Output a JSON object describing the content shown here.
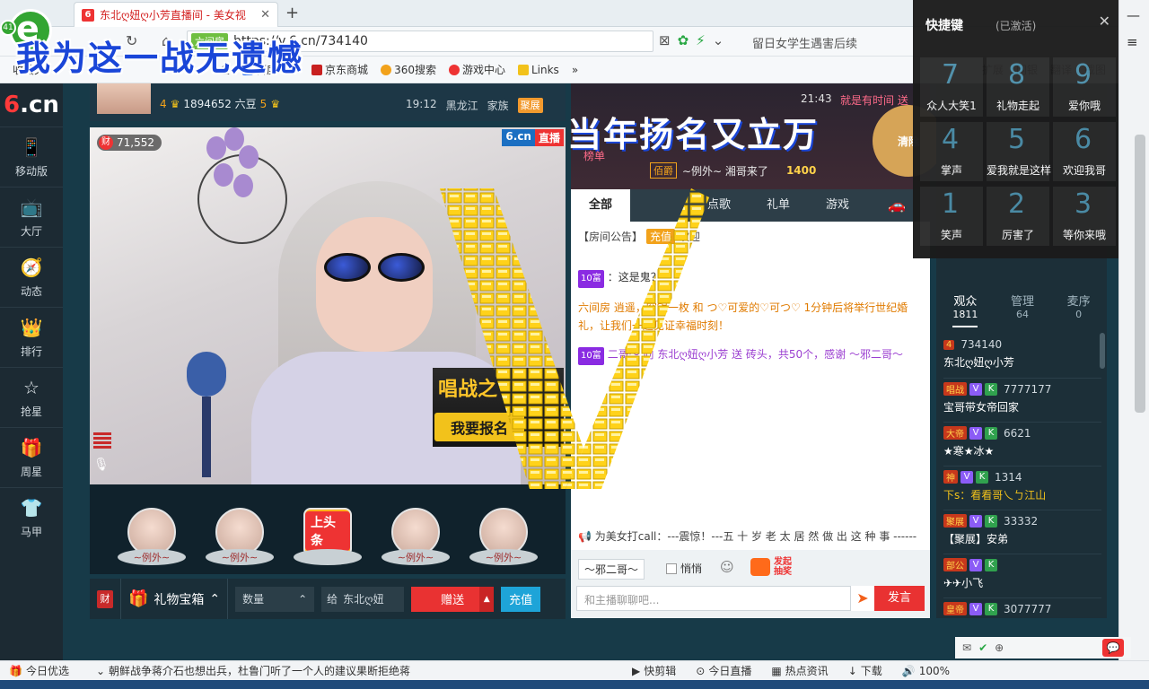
{
  "browser": {
    "tab_title": "东北ღ妞ღ小芳直播间 - 美女视",
    "tab_close": "✕",
    "new_tab": "+",
    "badge_number": "41",
    "address_safe_label": "六间房",
    "address_url": "https://v.6.cn/734140",
    "search_text": "留日女学生遇害后续",
    "bookmarks": [
      "收藏夹",
      "全",
      "百度一下",
      "京东商城",
      "360搜索",
      "游戏中心",
      "Links",
      "»"
    ],
    "bookmarks_right": [
      "扩展",
      "网银",
      "翻译",
      "截图",
      "模式"
    ]
  },
  "overlay_slogan": "我为这一战无遗憾",
  "site": {
    "logo_text": "6.cn",
    "logo_sub": "六间房",
    "nav": [
      {
        "icon": "📱",
        "label": "移动版"
      },
      {
        "icon": "📺",
        "label": "大厅"
      },
      {
        "icon": "🧭",
        "label": "动态"
      },
      {
        "icon": "👑",
        "label": "排行"
      },
      {
        "icon": "☆",
        "label": "抢星"
      },
      {
        "icon": "🎁",
        "label": "周星"
      },
      {
        "icon": "👕",
        "label": "马甲"
      }
    ]
  },
  "room": {
    "level_left": "4",
    "beans": "1894652 六豆",
    "level_right": "5",
    "time": "19:12",
    "location": "黑龙江",
    "family_label": "家族",
    "family_tag": "聚展"
  },
  "video": {
    "viewer_count": "71,552",
    "cai": "财",
    "cn_badge": "6.cn",
    "live_badge": "直播",
    "sing_title": "唱战之",
    "sing_button": "我要报名"
  },
  "gift_strip": {
    "slots": [
      "∼例外∼",
      "∼例外∼",
      "上头条",
      "∼例外∼",
      "∼例外∼"
    ]
  },
  "gift_bar": {
    "cai": "财",
    "giftbox_label": "礼物宝箱",
    "qty_placeholder": "数量",
    "to_label": "给",
    "to_name": "东北ღ妞",
    "send_label": "赠送",
    "recharge_label": "充值"
  },
  "chat": {
    "time": "21:43",
    "slogan": "就是有时间 送",
    "big_title": "当年扬名又立万",
    "rank_label": "榜单",
    "rank_tag": "佰爵",
    "rank_name": "∼例外∼ 湘哥来了",
    "rank_num": "1400",
    "clear_label": "清除",
    "tabs": [
      "全部",
      "",
      "点歌",
      "礼单",
      "游戏",
      "🚗"
    ],
    "notice_label": "【房间公告】",
    "notice_recharge": "充值",
    "notice_welcome": "欢迎",
    "messages": [
      {
        "level": "10富",
        "text": "：这是鬼？"
      },
      {
        "level": "",
        "text": "六间房 逍遥，穷银一枚 和 つ♡可爱的♡可つ♡ 1分钟后将举行世纪婚礼，让我们一起见证幸福时刻！"
      },
      {
        "level": "10富",
        "text": "二哥～ 向 东北ღ妞ღ小芳 送 砖头，共50个，感谢 ～邪二哥～"
      }
    ],
    "call_line": "为美女打call：---震惊！---五 十 岁 老 太 居 然 做 出 这 种 事 ------",
    "to_chip": "～邪二哥～",
    "quiet_label": "悄悄",
    "lottery_label": "发起抽奖",
    "input_placeholder": "和主播聊聊吧...",
    "speak_label": "发言"
  },
  "audience": {
    "tabs": [
      {
        "label": "观众",
        "count": "1811"
      },
      {
        "label": "管理",
        "count": "64"
      },
      {
        "label": "麦序",
        "count": "0"
      }
    ],
    "items": [
      {
        "badge": "4",
        "id": "734140",
        "name": "东北ღ妞ღ小芳"
      },
      {
        "badge": "唱战",
        "id": "7777177",
        "name": "宝哥带女帝回家"
      },
      {
        "badge": "大帝",
        "id": "6621",
        "name": "★寒★冰★"
      },
      {
        "badge": "神",
        "id": "1314",
        "name": "下s：看看哥乀ㄅ江山"
      },
      {
        "badge": "聚展",
        "id": "33332",
        "name": "【聚展】安弟"
      },
      {
        "badge": "部公",
        "id": "",
        "name": "✈✈小飞"
      },
      {
        "badge": "皇帝",
        "id": "3077777",
        "name": ""
      }
    ]
  },
  "shortcut": {
    "title": "快捷键",
    "subtitle": "(已激活)",
    "close": "✕",
    "cells": [
      {
        "num": "7",
        "label": "众人大笑1"
      },
      {
        "num": "8",
        "label": "礼物走起"
      },
      {
        "num": "9",
        "label": "爱你哦"
      },
      {
        "num": "4",
        "label": "掌声"
      },
      {
        "num": "5",
        "label": "爱我就是这样"
      },
      {
        "num": "6",
        "label": "欢迎我哥"
      },
      {
        "num": "1",
        "label": "笑声"
      },
      {
        "num": "2",
        "label": "厉害了"
      },
      {
        "num": "3",
        "label": "等你来哦"
      }
    ]
  },
  "statusbar": {
    "today": "今日优选",
    "news": "朝鲜战争蒋介石也想出兵，杜鲁门听了一个人的建议果断拒绝蒋",
    "right_items": [
      "快剪辑",
      "今日直播",
      "热点资讯",
      "下载",
      "100%"
    ]
  }
}
